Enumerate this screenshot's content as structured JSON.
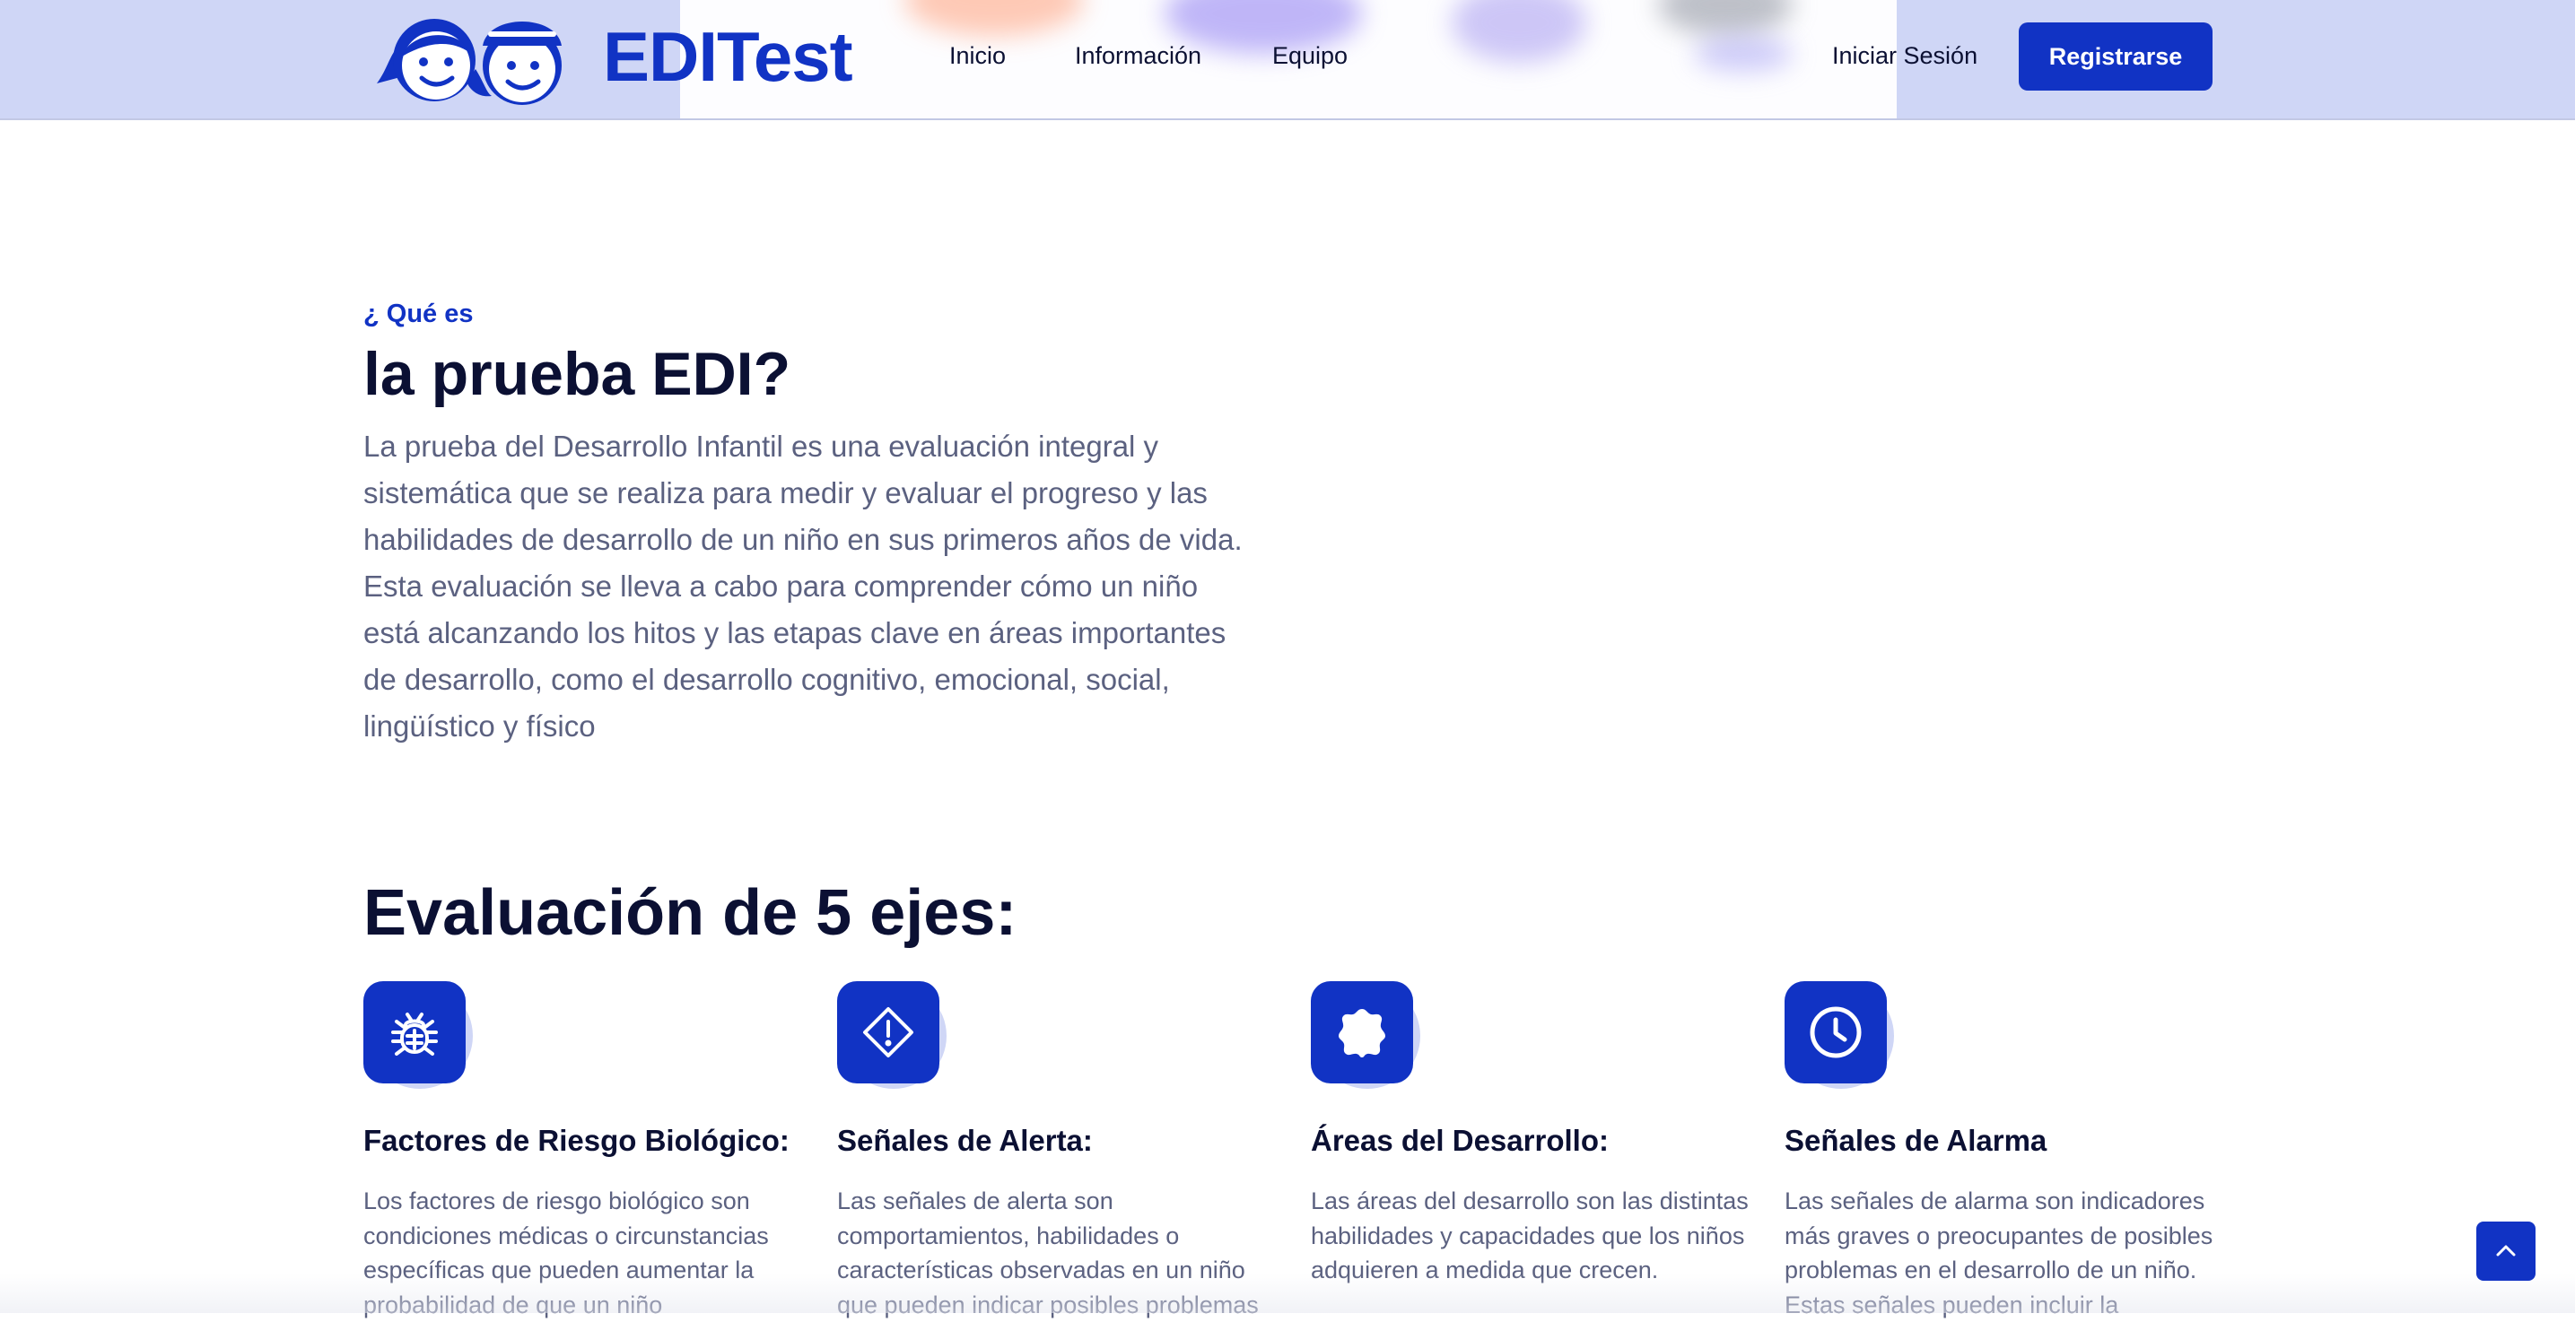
{
  "brand": {
    "name": "EDITest"
  },
  "nav": {
    "items": [
      {
        "label": "Inicio"
      },
      {
        "label": "Información"
      },
      {
        "label": "Equipo"
      }
    ],
    "login_label": "Iniciar Sesión",
    "register_label": "Registrarse"
  },
  "intro": {
    "eyebrow": "¿ Qué es",
    "title": "la prueba EDI?",
    "body": "La prueba del Desarrollo Infantil es una evaluación integral y sistemática que se realiza para medir y evaluar el progreso y las habilidades de desarrollo de un niño en sus primeros años de vida. Esta evaluación se lleva a cabo para comprender cómo un niño está alcanzando los hitos y las etapas clave en áreas importantes de desarrollo, como el desarrollo cognitivo, emocional, social, lingüístico y físico"
  },
  "features": {
    "title": "Evaluación de 5 ejes:",
    "cards": [
      {
        "icon": "bug-icon",
        "title": "Factores de Riesgo Biológico:",
        "text": "Los factores de riesgo biológico son condiciones médicas o circunstancias específicas que pueden aumentar la probabilidad de que un niño"
      },
      {
        "icon": "alert-diamond-icon",
        "title": "Señales de Alerta:",
        "text": "Las señales de alerta son comportamientos, habilidades o características observadas en un niño que pueden indicar posibles problemas"
      },
      {
        "icon": "badge-icon",
        "title": "Áreas del Desarrollo:",
        "text": "Las áreas del desarrollo son las distintas habilidades y capacidades que los niños adquieren a medida que crecen."
      },
      {
        "icon": "clock-icon",
        "title": "Señales de Alarma",
        "text": "Las señales de alarma son indicadores más graves o preocupantes de posibles problemas en el desarrollo de un niño. Estas señales pueden incluir la"
      }
    ]
  },
  "colors": {
    "accent": "#1133c4",
    "header_bg": "#cfd6f6",
    "heading": "#0b1033",
    "body_text": "#5b6180"
  },
  "scroll_top": {
    "icon": "chevron-up-icon"
  }
}
